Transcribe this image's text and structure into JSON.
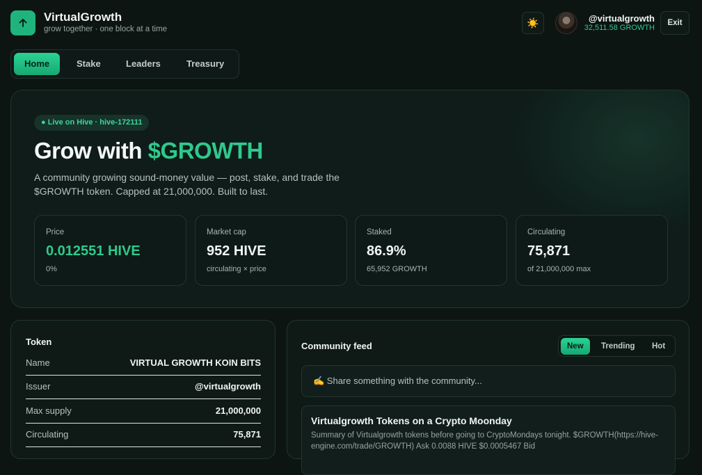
{
  "header": {
    "brand_title": "VirtualGrowth",
    "brand_subtitle": "grow together · one block at a time",
    "theme_icon": "☀️",
    "username": "@virtualgrowth",
    "balance": "32,511.58 GROWTH",
    "exit_label": "Exit"
  },
  "nav": {
    "tabs": [
      {
        "label": "Home",
        "active": true
      },
      {
        "label": "Stake",
        "active": false
      },
      {
        "label": "Leaders",
        "active": false
      },
      {
        "label": "Treasury",
        "active": false
      }
    ]
  },
  "hero": {
    "badge": "● Live on Hive · hive-172111",
    "title_prefix": "Grow with ",
    "title_accent": "$GROWTH",
    "description": "A community growing sound-money value — post, stake, and trade the $GROWTH token. Capped at 21,000,000. Built to last.",
    "stats": [
      {
        "label": "Price",
        "value": "0.012551 HIVE",
        "sub": "0%"
      },
      {
        "label": "Market cap",
        "value": "952 HIVE",
        "sub": "circulating × price"
      },
      {
        "label": "Staked",
        "value": "86.9%",
        "sub": "65,952 GROWTH"
      },
      {
        "label": "Circulating",
        "value": "75,871",
        "sub": "of 21,000,000 max"
      }
    ]
  },
  "token": {
    "title": "Token",
    "rows": [
      {
        "key": "Name",
        "value": "VIRTUAL GROWTH KOIN BITS"
      },
      {
        "key": "Issuer",
        "value": "@virtualgrowth"
      },
      {
        "key": "Max supply",
        "value": "21,000,000"
      },
      {
        "key": "Circulating",
        "value": "75,871"
      }
    ]
  },
  "feed": {
    "title": "Community feed",
    "tabs": [
      {
        "label": "New",
        "active": true
      },
      {
        "label": "Trending",
        "active": false
      },
      {
        "label": "Hot",
        "active": false
      }
    ],
    "compose_placeholder": "✍️ Share something with the community...",
    "posts": [
      {
        "title": "Virtualgrowth Tokens on a Crypto Moonday",
        "body": "Summary of Virtualgrowth tokens before going to CryptoMondays tonight. $GROWTH(https://hive-engine.com/trade/GROWTH) Ask 0.0088 HIVE $0.0005467 Bid"
      }
    ]
  }
}
